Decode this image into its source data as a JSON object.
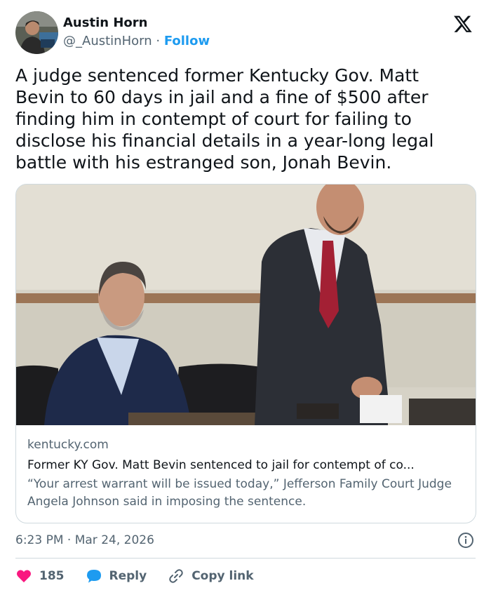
{
  "author": {
    "display_name": "Austin Horn",
    "handle": "@_AustinHorn",
    "separator": "·",
    "follow_label": "Follow"
  },
  "tweet": {
    "text": "A judge sentenced former Kentucky Gov. Matt Bevin to 60 days in jail and a fine of $500 after finding him in contempt of court for failing to disclose his financial details in a year-long legal battle with his estranged son, Jonah Bevin."
  },
  "link_card": {
    "domain": "kentucky.com",
    "title": "Former KY Gov. Matt Bevin sentenced to jail for contempt of co...",
    "description": "“Your arrest warrant will be issued today,” Jefferson Family Court Judge Angela Johnson said in imposing the sentence."
  },
  "meta": {
    "timestamp": "6:23 PM · Mar 24, 2026"
  },
  "actions": {
    "like_count": "185",
    "reply_label": "Reply",
    "copy_link_label": "Copy link"
  },
  "colors": {
    "accent": "#1d9bf0",
    "like": "#f91880",
    "muted": "#536471",
    "text": "#0f1419",
    "border": "#cfd9de"
  },
  "icons": {
    "brand": "x-logo-icon",
    "info": "info-icon",
    "like": "heart-icon",
    "reply": "speech-bubble-icon",
    "copy": "link-icon"
  }
}
